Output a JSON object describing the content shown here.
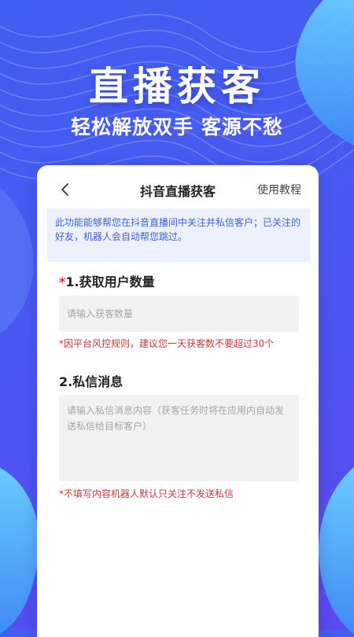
{
  "hero": {
    "title": "直播获客",
    "subtitle": "轻松解放双手 客源不愁"
  },
  "nav": {
    "back_icon": "chevron-left-icon",
    "title": "抖音直播获客",
    "help_link": "使用教程"
  },
  "notice": {
    "text": "此功能能够帮您在抖音直播间中关注并私信客户；已关注的好友，机器人会自动帮您跳过。"
  },
  "user_count": {
    "required_mark": "*",
    "label": "1.获取用户数量",
    "placeholder": "请输入获客数量",
    "hint": "*因平台风控规则，建议您一天获客数不要超过30个"
  },
  "message": {
    "label": "2.私信消息",
    "placeholder": "请输入私信消息内容（获客任务时将在应用内自动发送私信给目标客户）",
    "hint": "*不填写内容机器人默认只关注不发送私信"
  },
  "colors": {
    "background": "#4a58f2",
    "accent_blue": "#3b62d8",
    "notice_bg": "#edf1fd",
    "warning_red": "#c23b3b"
  }
}
